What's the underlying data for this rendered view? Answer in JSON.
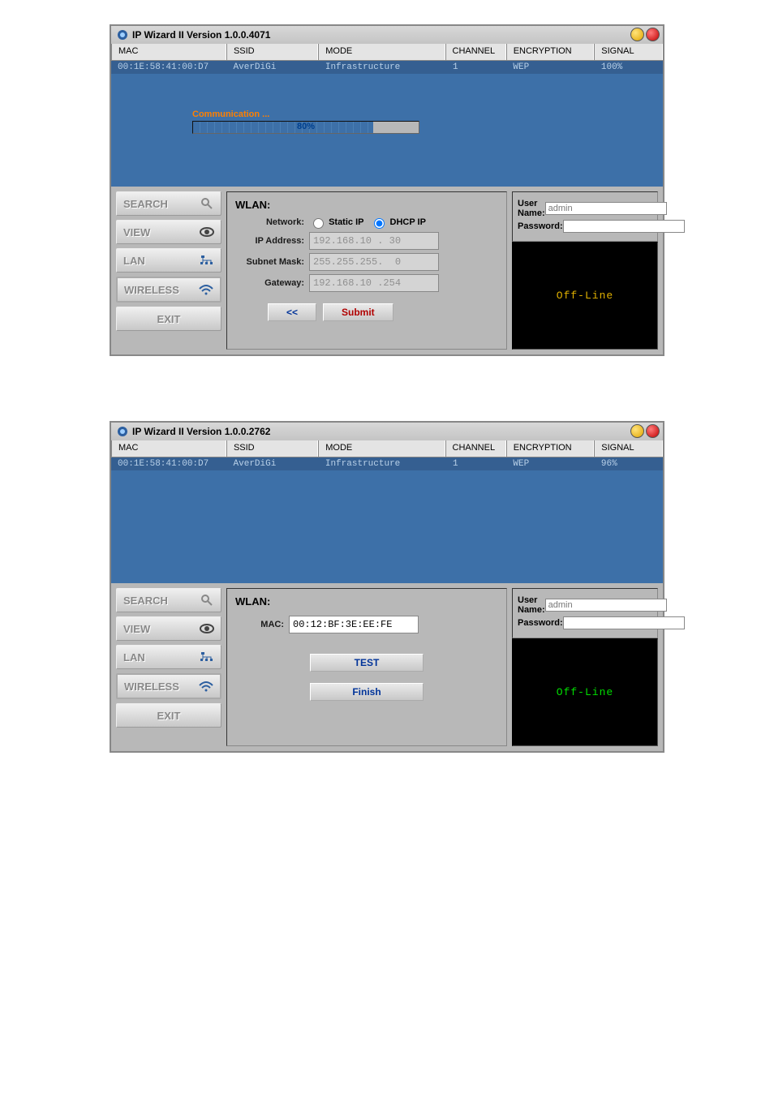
{
  "app1": {
    "title": "IP Wizard II  Version 1.0.0.4071",
    "cols": {
      "mac": "MAC",
      "ssid": "SSID",
      "mode": "MODE",
      "channel": "CHANNEL",
      "enc": "ENCRYPTION",
      "sig": "SIGNAL"
    },
    "row": {
      "mac": "00:1E:58:41:00:D7",
      "ssid": "AverDiGi",
      "mode": "Infrastructure",
      "channel": "1",
      "enc": "WEP",
      "sig": "100%"
    },
    "progress": {
      "label": "Communication ...",
      "pct": "80%",
      "pct_num": 80
    },
    "nav": {
      "search": "SEARCH",
      "view": "VIEW",
      "lan": "LAN",
      "wireless": "WIRELESS",
      "exit": "EXIT"
    },
    "form": {
      "title": "WLAN:",
      "network_label": "Network:",
      "static_ip": "Static IP",
      "dhcp_ip": "DHCP IP",
      "ip_label": "IP Address:",
      "ip_val": "192.168.10 . 30",
      "mask_label": "Subnet Mask:",
      "mask_val": "255.255.255.  0",
      "gw_label": "Gateway:",
      "gw_val": "192.168.10 .254",
      "back": "<<",
      "submit": "Submit"
    },
    "auth": {
      "user_label": "User Name:",
      "user_val": "admin",
      "pass_label": "Password:",
      "pass_val": "",
      "status": "Off-Line"
    }
  },
  "app2": {
    "title": "IP Wizard II  Version 1.0.0.2762",
    "cols": {
      "mac": "MAC",
      "ssid": "SSID",
      "mode": "MODE",
      "channel": "CHANNEL",
      "enc": "ENCRYPTION",
      "sig": "SIGNAL"
    },
    "row": {
      "mac": "00:1E:58:41:00:D7",
      "ssid": "AverDiGi",
      "mode": "Infrastructure",
      "channel": "1",
      "enc": "WEP",
      "sig": "96%"
    },
    "nav": {
      "search": "SEARCH",
      "view": "VIEW",
      "lan": "LAN",
      "wireless": "WIRELESS",
      "exit": "EXIT"
    },
    "form": {
      "title": "WLAN:",
      "mac_label": "MAC:",
      "mac_val": "00:12:BF:3E:EE:FE",
      "test": "TEST",
      "finish": "Finish"
    },
    "auth": {
      "user_label": "User Name:",
      "user_val": "admin",
      "pass_label": "Password:",
      "pass_val": "",
      "status": "Off-Line"
    }
  }
}
